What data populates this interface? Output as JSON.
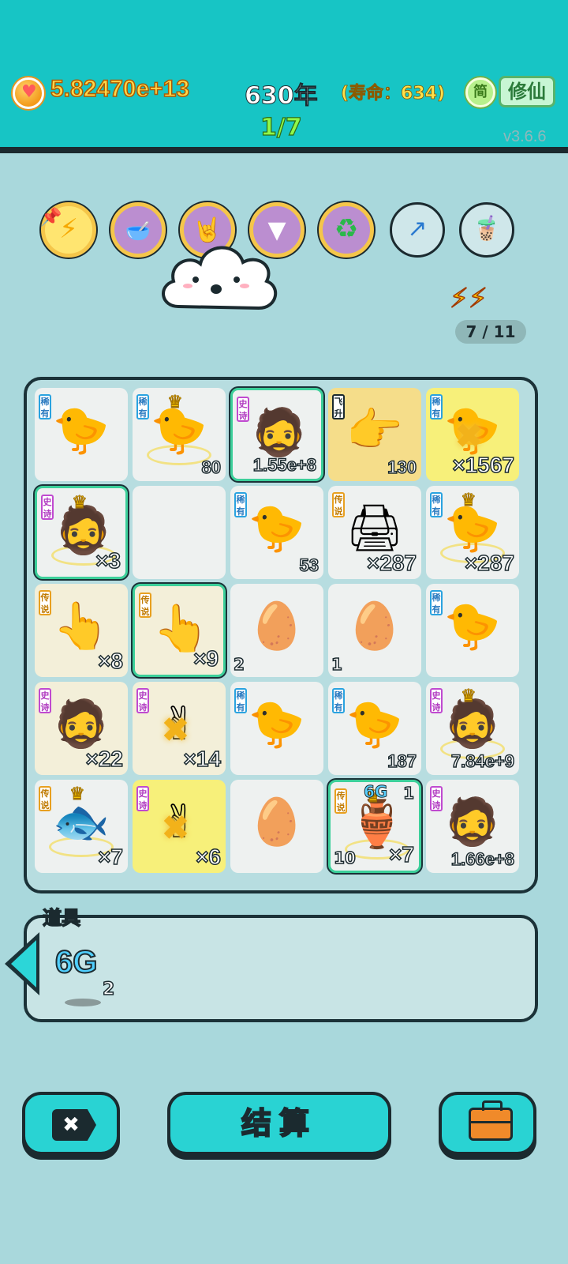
{
  "header": {
    "score": "5.82470e+13",
    "year": "630年",
    "lifespan": "(寿命：634)",
    "stage": "1/7",
    "simplified_label": "简",
    "cultivate_label": "修仙",
    "version": "v3.6.6"
  },
  "skills": [
    {
      "icon": "lightning-icon"
    },
    {
      "icon": "dual-bowls-icon"
    },
    {
      "icon": "rock-hand-icon"
    },
    {
      "icon": "skirt-icon"
    },
    {
      "icon": "recycle-icon"
    },
    {
      "icon": "arrow-up-icon"
    },
    {
      "icon": "bubble-tea-icon"
    }
  ],
  "energy": {
    "text": "7 / 11"
  },
  "board": {
    "cells": [
      {
        "tag": "稀有",
        "tag_type": "rare",
        "item": "chick-icon",
        "count": ""
      },
      {
        "tag": "稀有",
        "tag_type": "rare",
        "item": "crowned-chick-icon",
        "count": "80"
      },
      {
        "tag": "史诗",
        "tag_type": "epic",
        "item": "bearded-man-icon",
        "count": "1.55e+8"
      },
      {
        "tag": "飞升",
        "tag_type": "fly",
        "item": "pointing-hand-icon",
        "count": "130"
      },
      {
        "tag": "稀有",
        "tag_type": "rare",
        "item": "cursed-chick-icon",
        "count": "×1567"
      },
      {
        "tag": "史诗",
        "tag_type": "epic",
        "item": "crowned-man-icon",
        "count": "×3"
      },
      {
        "tag": "",
        "tag_type": "",
        "item": "",
        "count": ""
      },
      {
        "tag": "稀有",
        "tag_type": "rare",
        "item": "chick-icon",
        "count": "53"
      },
      {
        "tag": "传说",
        "tag_type": "legend",
        "item": "printer-icon",
        "count": "×287"
      },
      {
        "tag": "稀有",
        "tag_type": "rare",
        "item": "crowned-chick-icon",
        "count": "×287"
      },
      {
        "tag": "传说",
        "tag_type": "legend",
        "item": "yellow-hand-icon",
        "count": "×8"
      },
      {
        "tag": "传说",
        "tag_type": "legend",
        "item": "yellow-hand-icon",
        "count": "×9"
      },
      {
        "tag": "",
        "tag_type": "",
        "item": "egg-icon",
        "count": "2"
      },
      {
        "tag": "",
        "tag_type": "",
        "item": "egg-icon",
        "count": "1"
      },
      {
        "tag": "稀有",
        "tag_type": "rare",
        "item": "chick-icon",
        "count": ""
      },
      {
        "tag": "史诗",
        "tag_type": "epic",
        "item": "bearded-man-icon",
        "count": "×22"
      },
      {
        "tag": "史诗",
        "tag_type": "epic",
        "item": "grey-hand-icon",
        "count": "×14"
      },
      {
        "tag": "稀有",
        "tag_type": "rare",
        "item": "chick-icon",
        "count": ""
      },
      {
        "tag": "稀有",
        "tag_type": "rare",
        "item": "chick-icon",
        "count": "187"
      },
      {
        "tag": "史诗",
        "tag_type": "epic",
        "item": "crowned-man-icon",
        "count": "7.84e+9"
      },
      {
        "tag": "传说",
        "tag_type": "legend",
        "item": "koi-fish-icon",
        "count": "×7"
      },
      {
        "tag": "史诗",
        "tag_type": "epic",
        "item": "grey-hand-icon",
        "count": "×6"
      },
      {
        "tag": "",
        "tag_type": "",
        "item": "egg-icon",
        "count": ""
      },
      {
        "tag": "传说",
        "tag_type": "legend",
        "item": "green-vase-icon",
        "count": "×7",
        "extra_left": "10",
        "extra_top": "1",
        "extra_label": "6G"
      },
      {
        "tag": "史诗",
        "tag_type": "epic",
        "item": "bearded-man-icon",
        "count": "1.66e+8"
      }
    ]
  },
  "items": {
    "title": "道具",
    "entry_label": "6G",
    "entry_count": "2"
  },
  "buttons": {
    "settle_label": "结算"
  }
}
